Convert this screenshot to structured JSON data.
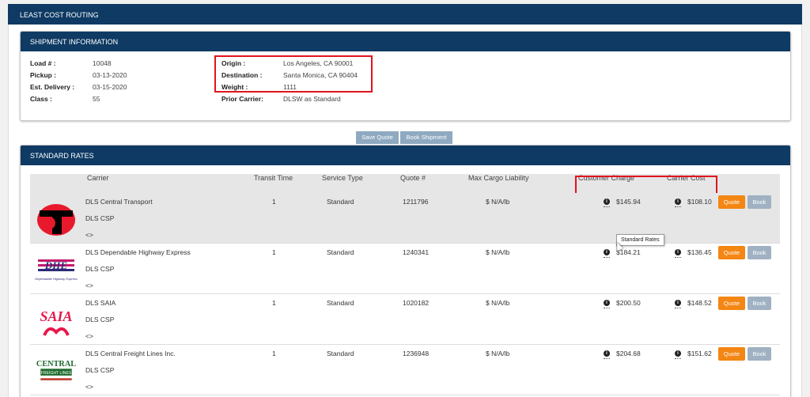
{
  "page": {
    "title": "LEAST COST ROUTING",
    "shipment_title": "SHIPMENT INFORMATION",
    "rates_title": "STANDARD RATES"
  },
  "shipment": {
    "load_label": "Load # :",
    "load_value": "10048",
    "pickup_label": "Pickup :",
    "pickup_value": "03-13-2020",
    "delivery_label": "Est. Delivery :",
    "delivery_value": "03-15-2020",
    "class_label": "Class :",
    "class_value": "55",
    "origin_label": "Origin :",
    "origin_value": "Los Angeles, CA 90001",
    "destination_label": "Destination :",
    "destination_value": "Santa Monica, CA 90404",
    "weight_label": "Weight :",
    "weight_value": "1111",
    "prior_label": "Prior Carrier:",
    "prior_value": "DLSW as Standard"
  },
  "actions": {
    "save_quote": "Save Quote",
    "book_shipment": "Book Shipment"
  },
  "table": {
    "headers": {
      "carrier": "Carrier",
      "transit": "Transit Time",
      "service": "Service Type",
      "quote": "Quote #",
      "liability": "Max Cargo Liability",
      "customer_charge": "Customer Charge",
      "carrier_cost": "Carrier Cost"
    },
    "rows": [
      {
        "carrier": "DLS Central Transport",
        "csp": "DLS CSP",
        "toggle": "<>",
        "transit": "1",
        "service": "Standard",
        "quote": "1211796",
        "liability": "$ N/A/lb",
        "charge": "$145.94",
        "cost": "$108.10",
        "quote_btn": "Quote",
        "book_btn": "Book",
        "logo": "central-transport-logo"
      },
      {
        "carrier": "DLS Dependable Highway Express",
        "csp": "DLS CSP",
        "toggle": "<>",
        "transit": "1",
        "service": "Standard",
        "quote": "1240341",
        "liability": "$ N/A/lb",
        "charge": "$184.21",
        "cost": "$136.45",
        "quote_btn": "Quote",
        "book_btn": "Book",
        "logo": "dhe-logo",
        "logo_text": "DHE",
        "logo_sub": "Dependable Highway Express"
      },
      {
        "carrier": "DLS SAIA",
        "csp": "DLS CSP",
        "toggle": "<>",
        "transit": "1",
        "service": "Standard",
        "quote": "1020182",
        "liability": "$ N/A/lb",
        "charge": "$200.50",
        "cost": "$148.52",
        "quote_btn": "Quote",
        "book_btn": "Book",
        "logo": "saia-logo",
        "logo_text": "SAIA"
      },
      {
        "carrier": "DLS Central Freight Lines Inc.",
        "csp": "DLS CSP",
        "toggle": "<>",
        "transit": "1",
        "service": "Standard",
        "quote": "1236948",
        "liability": "$ N/A/lb",
        "charge": "$204.68",
        "cost": "$151.62",
        "quote_btn": "Quote",
        "book_btn": "Book",
        "logo": "central-freight-logo",
        "logo_text": "CENTRAL",
        "logo_sub": "FREIGHT LINES"
      }
    ]
  },
  "tooltip": "Standard Rates",
  "colors": {
    "header": "#0e3a63",
    "quote": "#f48613",
    "book": "#9fb1c2",
    "highlight": "#e0141e"
  }
}
